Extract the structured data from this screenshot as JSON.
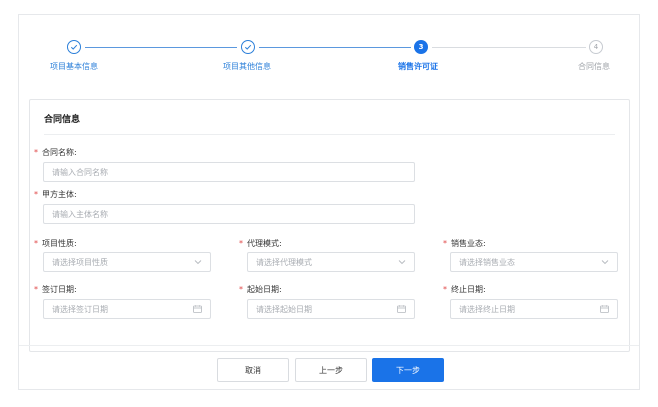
{
  "steps": [
    {
      "label": "项目基本信息",
      "status": "done"
    },
    {
      "label": "项目其他信息",
      "status": "done"
    },
    {
      "label": "销售许可证",
      "status": "current",
      "number": "3"
    },
    {
      "label": "合同信息",
      "status": "todo",
      "number": "4"
    }
  ],
  "panel": {
    "title": "合同信息",
    "required_mark": "*",
    "fields": {
      "contract_name": {
        "label": "合同名称:",
        "placeholder": "请输入合同名称"
      },
      "party_a": {
        "label": "甲方主体:",
        "placeholder": "请输入主体名称"
      },
      "project_nature": {
        "label": "项目性质:",
        "placeholder": "请选择项目性质"
      },
      "agency_mode": {
        "label": "代理模式:",
        "placeholder": "请选择代理模式"
      },
      "sales_status": {
        "label": "销售业态:",
        "placeholder": "请选择销售业态"
      },
      "sign_date": {
        "label": "签订日期:",
        "placeholder": "请选择签订日期"
      },
      "start_date": {
        "label": "起始日期:",
        "placeholder": "请选择起始日期"
      },
      "end_date": {
        "label": "终止日期:",
        "placeholder": "请选择终止日期"
      }
    }
  },
  "footer": {
    "cancel_label": "取消",
    "prev_label": "上一步",
    "next_label": "下一步"
  },
  "colors": {
    "primary": "#1a73e8",
    "required": "#e04848",
    "border": "#dcdfe3"
  },
  "icons": {
    "done_step": "check-circle-icon",
    "select_arrow": "chevron-down-icon",
    "date": "calendar-icon"
  }
}
